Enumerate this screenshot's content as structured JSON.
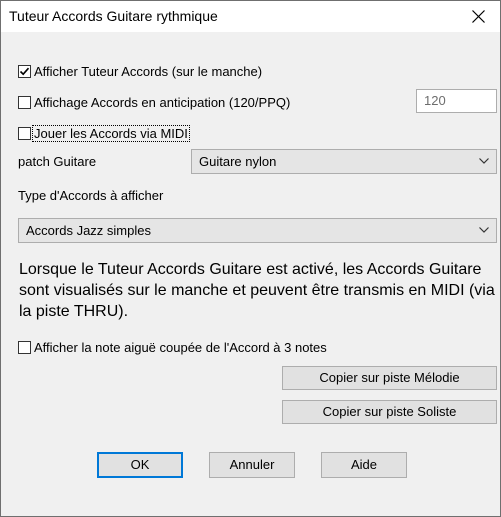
{
  "window": {
    "title": "Tuteur Accords Guitare rythmique"
  },
  "options": {
    "show_tutor": {
      "label": "Afficher Tuteur Accords (sur le manche)",
      "checked": true
    },
    "anticipation": {
      "label": "Affichage Accords en anticipation (120/PPQ)",
      "checked": false
    },
    "anticipation_value": "120",
    "play_midi": {
      "label": "Jouer les Accords via MIDI",
      "checked": false
    },
    "show_top_note": {
      "label": "Afficher la note aiguë coupée de l'Accord à 3 notes",
      "checked": false
    }
  },
  "patch": {
    "label": "patch Guitare",
    "value": "Guitare nylon"
  },
  "chord_type": {
    "label": "Type d'Accords à afficher",
    "value": "Accords Jazz simples"
  },
  "description": "Lorsque le Tuteur Accords Guitare est activé, les Accords Guitare sont visualisés sur le manche et peuvent être transmis en MIDI (via la piste THRU).",
  "buttons": {
    "copy_melody": "Copier sur piste Mélodie",
    "copy_soloist": "Copier sur piste Soliste",
    "ok": "OK",
    "cancel": "Annuler",
    "help": "Aide"
  },
  "icons": {
    "close": "close-icon",
    "check": "checkmark-icon",
    "dropdown": "chevron-down-icon"
  },
  "colors": {
    "dialog_bg": "#f0f0f0",
    "titlebar_bg": "#ffffff",
    "button_bg": "#e1e1e1",
    "default_button_border": "#0078d7"
  }
}
